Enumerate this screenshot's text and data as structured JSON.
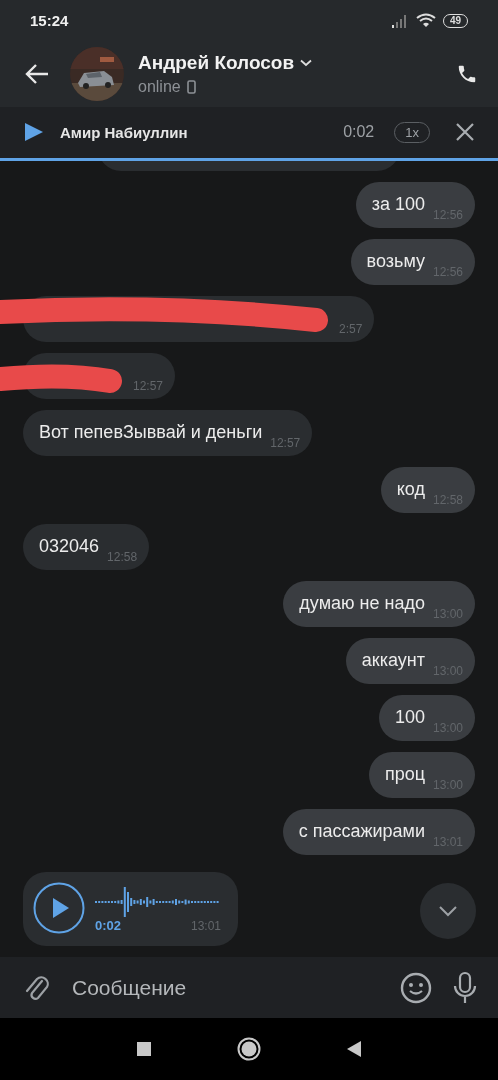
{
  "status_bar": {
    "time": "15:24",
    "battery": "49"
  },
  "header": {
    "name": "Андрей Колосов",
    "status": "online"
  },
  "player": {
    "title": "Амир Набиуллин",
    "elapsed": "0:02",
    "speed": "1x"
  },
  "messages": [
    {
      "kind": "partial",
      "outgoing": false
    },
    {
      "kind": "text",
      "outgoing": true,
      "text": "за 100",
      "time": "12:56"
    },
    {
      "kind": "text",
      "outgoing": true,
      "text": "возьму",
      "time": "12:56"
    },
    {
      "kind": "redacted",
      "outgoing": false,
      "time": "2:57"
    },
    {
      "kind": "redacted",
      "outgoing": false,
      "time": "12:57"
    },
    {
      "kind": "text",
      "outgoing": false,
      "text": "Вот пепевЗыввай и деньги",
      "time": "12:57"
    },
    {
      "kind": "text",
      "outgoing": true,
      "text": "код",
      "time": "12:58"
    },
    {
      "kind": "text",
      "outgoing": false,
      "text": "032046",
      "time": "12:58"
    },
    {
      "kind": "text",
      "outgoing": true,
      "text": "думаю не надо",
      "time": "13:00"
    },
    {
      "kind": "text",
      "outgoing": true,
      "text": "аккаунт",
      "time": "13:00"
    },
    {
      "kind": "text",
      "outgoing": true,
      "text": "100",
      "time": "13:00"
    },
    {
      "kind": "text",
      "outgoing": true,
      "text": "проц",
      "time": "13:00"
    },
    {
      "kind": "text",
      "outgoing": true,
      "text": "с пассажирами",
      "time": "13:01"
    },
    {
      "kind": "voice",
      "outgoing": false,
      "duration": "0:02",
      "time": "13:01"
    }
  ],
  "composer": {
    "placeholder": "Сообщение"
  }
}
